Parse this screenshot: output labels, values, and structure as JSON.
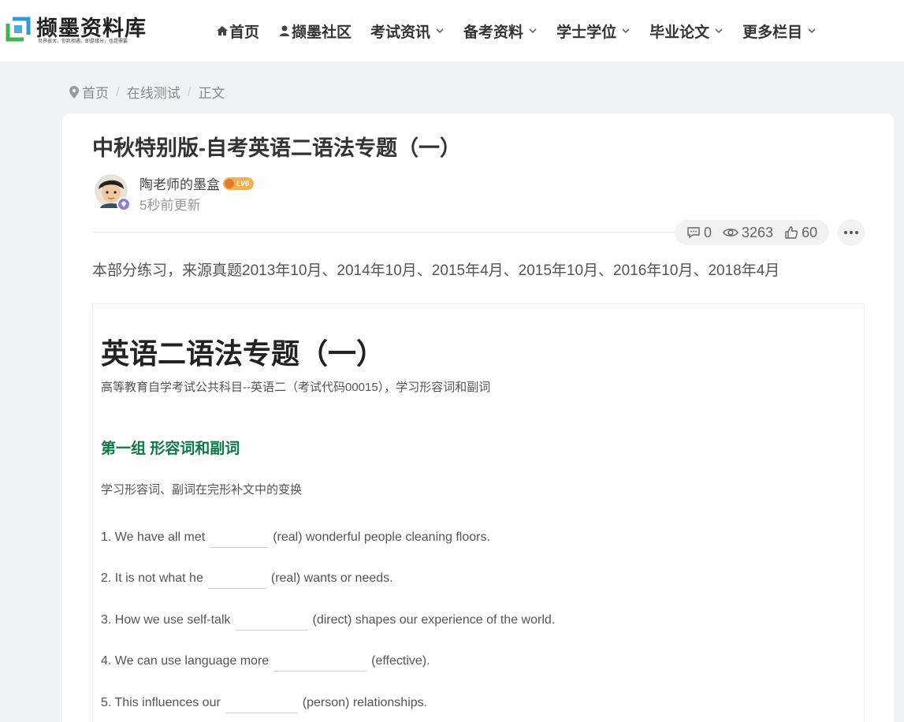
{
  "site": {
    "logo_text": "撷墨资料库",
    "logo_slogan": "世界很大，你我相遇，即是缘分，也是需要",
    "brand_colors": [
      "#2e9bd6",
      "#3fb34f"
    ]
  },
  "nav": {
    "items": [
      {
        "label": "首页",
        "icon": "home-icon",
        "dropdown": false
      },
      {
        "label": "撷墨社区",
        "icon": "user-icon",
        "dropdown": false
      },
      {
        "label": "考试资讯",
        "dropdown": true
      },
      {
        "label": "备考资料",
        "dropdown": true
      },
      {
        "label": "学士学位",
        "dropdown": true
      },
      {
        "label": "毕业论文",
        "dropdown": true
      },
      {
        "label": "更多栏目",
        "dropdown": true
      }
    ]
  },
  "breadcrumb": {
    "items": [
      "首页",
      "在线测试",
      "正文"
    ],
    "separator": "/"
  },
  "post": {
    "title": "中秋特别版-自考英语二语法专题（一）",
    "author": "陶老师的墨盒",
    "level_badge": "LV6",
    "updated": "5秒前更新",
    "stats": {
      "comments": "0",
      "views": "3263",
      "likes": "60"
    },
    "intro": "本部分练习，来源真题2013年10月、2014年10月、2015年4月、2015年10月、2016年10月、2018年4月"
  },
  "embed": {
    "title": "英语二语法专题（一）",
    "subtitle": "高等教育自学考试公共科目--英语二（考试代码00015），学习形容词和副词",
    "group_title": "第一组 形容词和副词",
    "group_desc": "学习形容词、副词在完形补文中的变换",
    "questions": [
      {
        "before": "1. We have all met",
        "after": "(real) wonderful people cleaning floors."
      },
      {
        "before": "2. It is not what he",
        "after": "(real) wants or needs."
      },
      {
        "before": "3. How we use self-talk",
        "after": "(direct) shapes our experience of the world."
      },
      {
        "before": "4. We can use language more",
        "after": "(effective)."
      },
      {
        "before": "5. This influences our",
        "after": "(person) relationships."
      }
    ]
  },
  "colors": {
    "accent_green": "#0b7a4a",
    "badge_orange": "#f3b04f"
  }
}
